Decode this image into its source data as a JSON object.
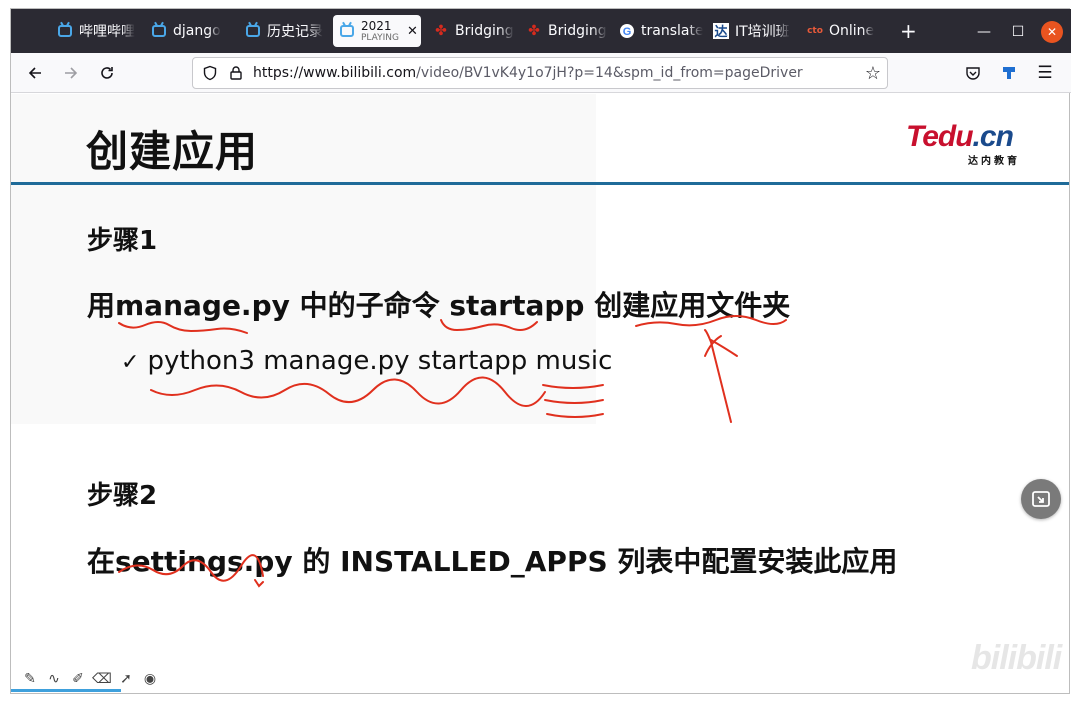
{
  "browser": {
    "tabs": [
      {
        "label": "哔哩哔哩",
        "icon": "bilibili-icon"
      },
      {
        "label": "django",
        "icon": "bilibili-icon"
      },
      {
        "label": "历史记录",
        "icon": "bilibili-icon"
      },
      {
        "label": "2021",
        "sublabel": "PLAYING",
        "icon": "bilibili-icon",
        "active": true
      },
      {
        "label": "Bridging",
        "icon": "maple-leaf-icon"
      },
      {
        "label": "Bridging",
        "icon": "maple-leaf-icon"
      },
      {
        "label": "translate",
        "icon": "google-icon"
      },
      {
        "label": "IT培训班",
        "icon": "tedu-icon"
      },
      {
        "label": "Online",
        "icon": "cto-icon"
      }
    ],
    "new_tab": "+",
    "url_host": "https://www.bilibili.com",
    "url_path": "/video/BV1vK4y1o7jH?p=14&spm_id_from=pageDriver"
  },
  "slide": {
    "title": "创建应用",
    "logo_text": "Tedu.cn",
    "logo_sub": "达内教育",
    "step1": {
      "heading": "步骤1",
      "text": "用manage.py 中的子命令 startapp 创建应用文件夹",
      "bullet": "python3 manage.py startapp music"
    },
    "step2": {
      "heading": "步骤2",
      "text": "在settings.py 的 INSTALLED_APPS 列表中配置安装此应用"
    },
    "watermark": "bilibili"
  },
  "colors": {
    "titlebar": "#2b2a33",
    "rule": "#1f6b99",
    "ink": "#e0301e",
    "brand_red": "#c8102e",
    "bili_blue": "#4aa7e8"
  }
}
